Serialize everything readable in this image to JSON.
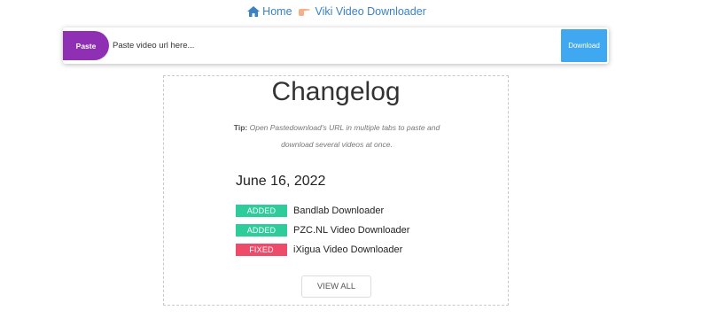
{
  "breadcrumb": {
    "home_label": "Home",
    "home_icon": "home-icon",
    "separator_icon": "pointing-hand-icon",
    "current_label": "Viki Video Downloader"
  },
  "search": {
    "paste_label": "Paste",
    "placeholder": "Paste video url here...",
    "value": "",
    "download_label": "Download"
  },
  "changelog": {
    "title": "Changelog",
    "tip_prefix": "Tip:",
    "tip_text": "Open Pastedownload's URL in multiple tabs to paste and download several videos at once.",
    "date": "June 16, 2022",
    "entries": [
      {
        "badge": "ADDED",
        "text": "Bandlab Downloader",
        "color": "#2ecc9a"
      },
      {
        "badge": "ADDED",
        "text": "PZC.NL Video Downloader",
        "color": "#2ecc9a"
      },
      {
        "badge": "FIXED",
        "text": "iXigua Video Downloader",
        "color": "#ee4b6a"
      }
    ],
    "view_all_label": "VIEW ALL"
  },
  "colors": {
    "link": "#3b82c4",
    "paste_button": "#8e2fb4",
    "download_button": "#3fa8f0",
    "added_badge": "#2ecc9a",
    "fixed_badge": "#ee4b6a"
  }
}
